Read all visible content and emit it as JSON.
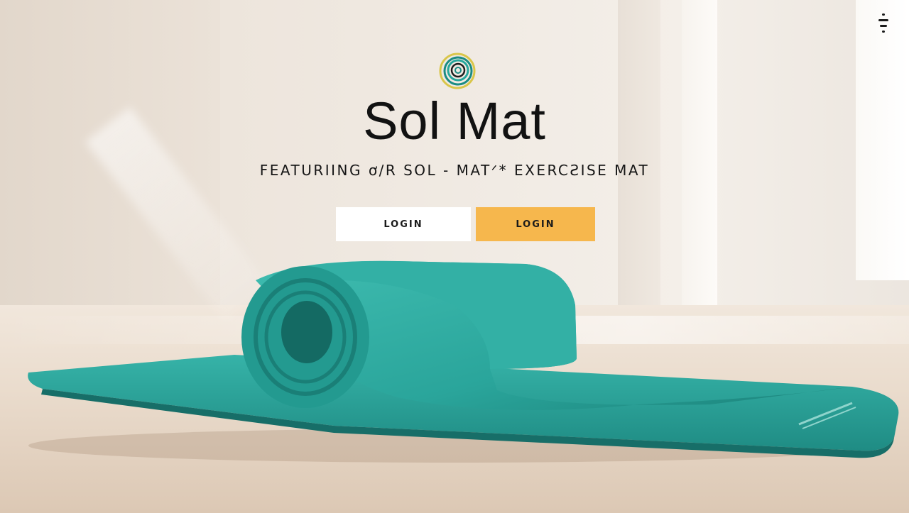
{
  "brand": {
    "title": "Sol Mat",
    "tagline": "FEATURIING ơ/R SOL - MATᐟ*   EXERCƧISE MAT",
    "logo_icon": "spiral-logo-icon"
  },
  "actions": {
    "login_primary_label": "LOGIN",
    "login_secondary_label": "LOGIN"
  },
  "nav": {
    "menu_icon": "hamburger-menu-icon"
  },
  "colors": {
    "accent": "#f6b74d",
    "mat": "#2aa59b",
    "text": "#121212"
  }
}
